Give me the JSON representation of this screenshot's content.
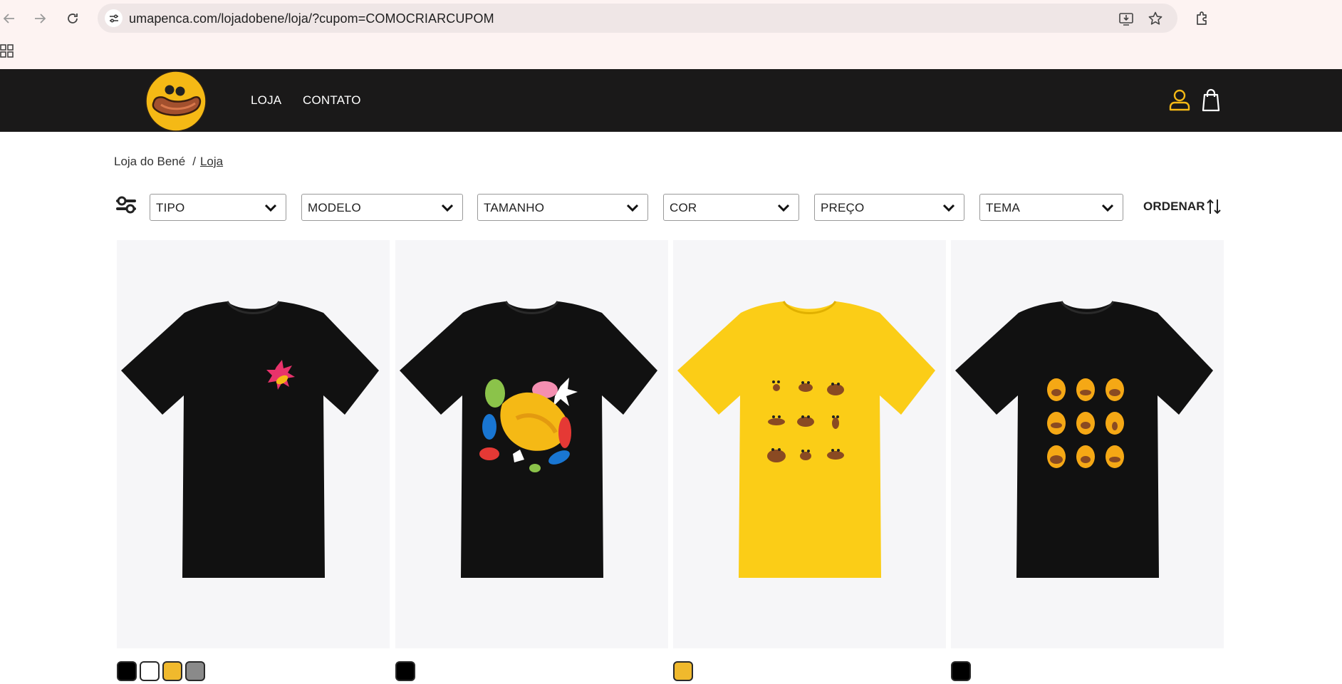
{
  "browser": {
    "url": "umapenca.com/lojadobene/loja/?cupom=COMOCRIARCUPOM",
    "icons": [
      "back-icon",
      "forward-icon",
      "reload-icon",
      "site-settings-icon",
      "install-icon",
      "star-icon",
      "extensions-icon",
      "apps-icon"
    ]
  },
  "header": {
    "menu": [
      "LOJA",
      "CONTATO"
    ],
    "icons": [
      "user-icon",
      "bag-icon"
    ]
  },
  "breadcrumb": {
    "home": "Loja do Bené",
    "separator": "/",
    "current": "Loja"
  },
  "filters": {
    "items": [
      "TIPO",
      "MODELO",
      "TAMANHO",
      "COR",
      "PREÇO",
      "TEMA"
    ],
    "order_label": "ORDENAR"
  },
  "products": [
    {
      "shirt_color": "#111111",
      "print": "small-chest-logo",
      "swatches": [
        "#000000",
        "#ffffff",
        "#f0b92d",
        "#8a8a8a"
      ]
    },
    {
      "shirt_color": "#111111",
      "print": "colorful-splash",
      "swatches": [
        "#000000"
      ]
    },
    {
      "shirt_color": "#fbcd17",
      "print": "faces-grid",
      "swatches": [
        "#f0b92d"
      ]
    },
    {
      "shirt_color": "#111111",
      "print": "yellow-characters-grid",
      "swatches": [
        "#000000"
      ]
    }
  ],
  "colors": {
    "header_bg": "#1a1919",
    "accent_yellow": "#f5b915",
    "chrome_bg": "#fdf3f2"
  }
}
